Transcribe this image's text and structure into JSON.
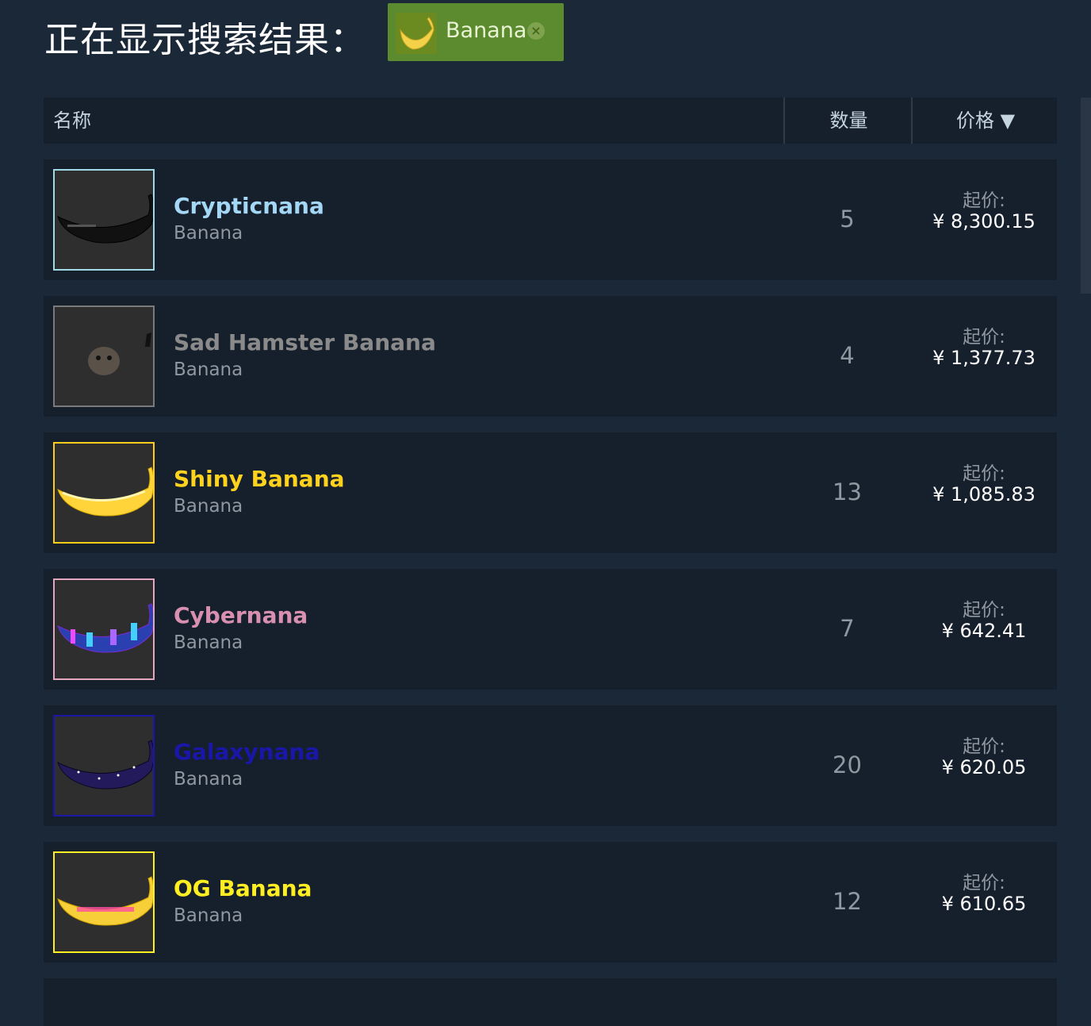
{
  "header": {
    "title": "正在显示搜索结果：",
    "filter_tag": {
      "label": "Banana",
      "icon": "banana-icon",
      "remove_icon": "close-circle-icon"
    }
  },
  "table": {
    "columns": {
      "name": "名称",
      "quantity": "数量",
      "price": "价格 ▼"
    }
  },
  "rows": [
    {
      "name": "Crypticnana",
      "type": "Banana",
      "quantity": "5",
      "price_label": "起价:",
      "price": "¥ 8,300.15",
      "name_color": "#a4d7f5",
      "border_color": "#9fd9e6",
      "icon": "crypticnana-icon"
    },
    {
      "name": "Sad Hamster Banana",
      "type": "Banana",
      "quantity": "4",
      "price_label": "起价:",
      "price": "¥ 1,377.73",
      "name_color": "#8a8a8a",
      "border_color": "#7a7a7a",
      "icon": "sad-hamster-icon"
    },
    {
      "name": "Shiny Banana",
      "type": "Banana",
      "quantity": "13",
      "price_label": "起价:",
      "price": "¥ 1,085.83",
      "name_color": "#ffd21e",
      "border_color": "#ffcc1a",
      "icon": "shiny-banana-icon"
    },
    {
      "name": "Cybernana",
      "type": "Banana",
      "quantity": "7",
      "price_label": "起价:",
      "price": "¥ 642.41",
      "name_color": "#d88fb0",
      "border_color": "#e3a6bf",
      "icon": "cybernana-icon"
    },
    {
      "name": "Galaxynana",
      "type": "Banana",
      "quantity": "20",
      "price_label": "起价:",
      "price": "¥ 620.05",
      "name_color": "#1a16a8",
      "border_color": "#1a16a8",
      "icon": "galaxynana-icon"
    },
    {
      "name": "OG Banana",
      "type": "Banana",
      "quantity": "12",
      "price_label": "起价:",
      "price": "¥ 610.65",
      "name_color": "#ffee22",
      "border_color": "#ffee22",
      "icon": "og-banana-icon"
    }
  ]
}
